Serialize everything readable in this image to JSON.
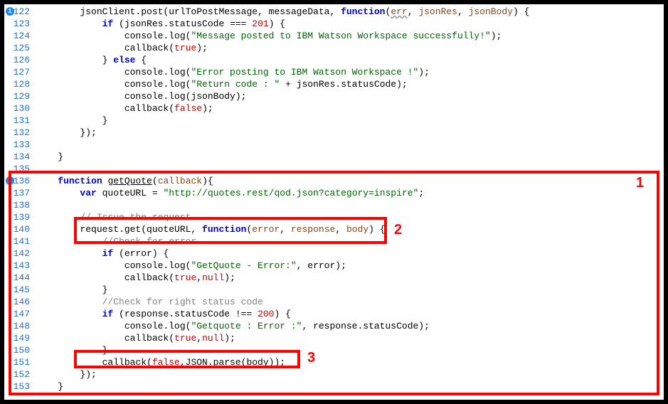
{
  "annotations": {
    "label1": "1",
    "label2": "2",
    "label3": "3"
  },
  "lines": [
    {
      "num": "122",
      "info": true,
      "tokens": [
        {
          "t": "        jsonClient.post(urlToPostMessage, messageData, ",
          "c": "code"
        },
        {
          "t": "function",
          "c": "kw"
        },
        {
          "t": "(",
          "c": "code"
        },
        {
          "t": "err",
          "c": "param under"
        },
        {
          "t": ", ",
          "c": "code"
        },
        {
          "t": "jsonRes",
          "c": "param"
        },
        {
          "t": ", ",
          "c": "code"
        },
        {
          "t": "jsonBody",
          "c": "param"
        },
        {
          "t": ") {",
          "c": "code"
        }
      ]
    },
    {
      "num": "123",
      "tokens": [
        {
          "t": "            ",
          "c": "code"
        },
        {
          "t": "if",
          "c": "kw"
        },
        {
          "t": " (jsonRes.statusCode === ",
          "c": "code"
        },
        {
          "t": "201",
          "c": "lit"
        },
        {
          "t": ") {",
          "c": "code"
        }
      ]
    },
    {
      "num": "124",
      "tokens": [
        {
          "t": "                console.log(",
          "c": "code"
        },
        {
          "t": "\"Message posted to IBM Watson Workspace successfully!\"",
          "c": "str"
        },
        {
          "t": ");",
          "c": "code"
        }
      ]
    },
    {
      "num": "125",
      "tokens": [
        {
          "t": "                callback(",
          "c": "code"
        },
        {
          "t": "true",
          "c": "lit"
        },
        {
          "t": ");",
          "c": "code"
        }
      ]
    },
    {
      "num": "126",
      "tokens": [
        {
          "t": "            } ",
          "c": "code"
        },
        {
          "t": "else",
          "c": "kw"
        },
        {
          "t": " {",
          "c": "code"
        }
      ]
    },
    {
      "num": "127",
      "tokens": [
        {
          "t": "                console.log(",
          "c": "code"
        },
        {
          "t": "\"Error posting to IBM Watson Workspace !\"",
          "c": "str"
        },
        {
          "t": ");",
          "c": "code"
        }
      ]
    },
    {
      "num": "128",
      "tokens": [
        {
          "t": "                console.log(",
          "c": "code"
        },
        {
          "t": "\"Return code : \"",
          "c": "str"
        },
        {
          "t": " + jsonRes.statusCode);",
          "c": "code"
        }
      ]
    },
    {
      "num": "129",
      "tokens": [
        {
          "t": "                console.log(jsonBody);",
          "c": "code"
        }
      ]
    },
    {
      "num": "130",
      "tokens": [
        {
          "t": "                callback(",
          "c": "code"
        },
        {
          "t": "false",
          "c": "lit"
        },
        {
          "t": ");",
          "c": "code"
        }
      ]
    },
    {
      "num": "131",
      "tokens": [
        {
          "t": "            }",
          "c": "code"
        }
      ]
    },
    {
      "num": "132",
      "tokens": [
        {
          "t": "        });",
          "c": "code"
        }
      ]
    },
    {
      "num": "133",
      "tokens": []
    },
    {
      "num": "134",
      "tokens": [
        {
          "t": "    }",
          "c": "code"
        }
      ]
    },
    {
      "num": "135",
      "tokens": []
    },
    {
      "num": "136",
      "info": true,
      "tokens": [
        {
          "t": "    ",
          "c": "code"
        },
        {
          "t": "function",
          "c": "kw"
        },
        {
          "t": " ",
          "c": "code"
        },
        {
          "t": "getQuote",
          "c": "deffn"
        },
        {
          "t": "(",
          "c": "code"
        },
        {
          "t": "callback",
          "c": "param"
        },
        {
          "t": "){",
          "c": "code"
        }
      ]
    },
    {
      "num": "137",
      "tokens": [
        {
          "t": "        ",
          "c": "code"
        },
        {
          "t": "var",
          "c": "kw"
        },
        {
          "t": " quoteURL = ",
          "c": "code"
        },
        {
          "t": "\"http://quotes.rest/qod.json?category=inspire\"",
          "c": "str"
        },
        {
          "t": ";",
          "c": "code"
        }
      ]
    },
    {
      "num": "138",
      "tokens": []
    },
    {
      "num": "139",
      "tokens": [
        {
          "t": "        ",
          "c": "code"
        },
        {
          "t": "// Issue the request",
          "c": "comment"
        }
      ]
    },
    {
      "num": "140",
      "tokens": [
        {
          "t": "        request.get(quoteURL, ",
          "c": "code"
        },
        {
          "t": "function",
          "c": "kw"
        },
        {
          "t": "(",
          "c": "code"
        },
        {
          "t": "error",
          "c": "param"
        },
        {
          "t": ", ",
          "c": "code"
        },
        {
          "t": "response",
          "c": "param"
        },
        {
          "t": ", ",
          "c": "code"
        },
        {
          "t": "body",
          "c": "param"
        },
        {
          "t": ") {",
          "c": "code"
        }
      ]
    },
    {
      "num": "141",
      "tokens": [
        {
          "t": "            ",
          "c": "code"
        },
        {
          "t": "//Check for error",
          "c": "comment"
        }
      ]
    },
    {
      "num": "142",
      "tokens": [
        {
          "t": "            ",
          "c": "code"
        },
        {
          "t": "if",
          "c": "kw"
        },
        {
          "t": " (error) {",
          "c": "code"
        }
      ]
    },
    {
      "num": "143",
      "tokens": [
        {
          "t": "                console.log(",
          "c": "code"
        },
        {
          "t": "\"GetQuote - Error:\"",
          "c": "str"
        },
        {
          "t": ", error);",
          "c": "code"
        }
      ]
    },
    {
      "num": "144",
      "tokens": [
        {
          "t": "                callback(",
          "c": "code"
        },
        {
          "t": "true",
          "c": "lit"
        },
        {
          "t": ",",
          "c": "code"
        },
        {
          "t": "null",
          "c": "lit"
        },
        {
          "t": ");",
          "c": "code"
        }
      ]
    },
    {
      "num": "145",
      "tokens": [
        {
          "t": "            }",
          "c": "code"
        }
      ]
    },
    {
      "num": "146",
      "tokens": [
        {
          "t": "            ",
          "c": "code"
        },
        {
          "t": "//Check for right status code",
          "c": "comment"
        }
      ]
    },
    {
      "num": "147",
      "tokens": [
        {
          "t": "            ",
          "c": "code"
        },
        {
          "t": "if",
          "c": "kw"
        },
        {
          "t": " (response.statusCode !== ",
          "c": "code"
        },
        {
          "t": "200",
          "c": "lit"
        },
        {
          "t": ") {",
          "c": "code"
        }
      ]
    },
    {
      "num": "148",
      "tokens": [
        {
          "t": "                console.log(",
          "c": "code"
        },
        {
          "t": "\"Getquote : Error :\"",
          "c": "str"
        },
        {
          "t": ", response.statusCode);",
          "c": "code"
        }
      ]
    },
    {
      "num": "149",
      "tokens": [
        {
          "t": "                callback(",
          "c": "code"
        },
        {
          "t": "true",
          "c": "lit"
        },
        {
          "t": ",",
          "c": "code"
        },
        {
          "t": "null",
          "c": "lit"
        },
        {
          "t": ");",
          "c": "code"
        }
      ]
    },
    {
      "num": "150",
      "tokens": [
        {
          "t": "            }",
          "c": "code"
        }
      ]
    },
    {
      "num": "151",
      "tokens": [
        {
          "t": "            callback(",
          "c": "code"
        },
        {
          "t": "false",
          "c": "lit"
        },
        {
          "t": ",JSON.parse(body));",
          "c": "code"
        }
      ]
    },
    {
      "num": "152",
      "tokens": [
        {
          "t": "        });",
          "c": "code"
        }
      ]
    },
    {
      "num": "153",
      "tokens": [
        {
          "t": "    }",
          "c": "code"
        }
      ]
    }
  ]
}
